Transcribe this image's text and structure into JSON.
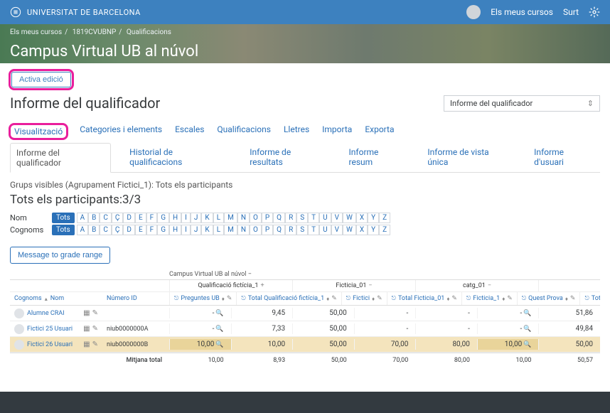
{
  "topbar": {
    "university": "UNIVERSITAT DE BARCELONA",
    "my_courses": "Els meus cursos",
    "logout": "Surt"
  },
  "breadcrumbs": [
    "Els meus cursos",
    "1819CVUBNP",
    "Qualificacions"
  ],
  "banner_title": "Campus Virtual UB al núvol",
  "edit_button": "Activa edició",
  "page_heading": "Informe del qualificador",
  "selector_value": "Informe del qualificador",
  "tabs1": [
    "Visualització",
    "Categories i elements",
    "Escales",
    "Qualificacions",
    "Lletres",
    "Importa",
    "Exporta"
  ],
  "tabs2": [
    "Informe del qualificador",
    "Historial de qualificacions",
    "Informe de resultats",
    "Informe resum",
    "Informe de vista única",
    "Informe d'usuari"
  ],
  "groups_text": "Grups visibles (Agrupament Fictici_1): Tots els participants",
  "participants_label": "Tots els participants:",
  "participants_count": "3/3",
  "letters": {
    "name_label": "Nom",
    "surname_label": "Cognoms",
    "all": "Tots",
    "alphabet": [
      "A",
      "B",
      "C",
      "Ç",
      "D",
      "E",
      "F",
      "G",
      "H",
      "I",
      "J",
      "K",
      "L",
      "M",
      "N",
      "O",
      "P",
      "Q",
      "R",
      "S",
      "T",
      "U",
      "V",
      "W",
      "X",
      "Y",
      "Z"
    ]
  },
  "message_button": "Message to grade range",
  "grade_table": {
    "top_label": "Campus Virtual UB al núvol",
    "categories": [
      {
        "label": "Qualificació fictícia_1",
        "sym": "+"
      },
      {
        "label": "Ficticia_01",
        "sym": "−"
      },
      {
        "label": "catg_01",
        "sym": "−"
      },
      {
        "label": "",
        "sym": ""
      }
    ],
    "left_headers": {
      "surname": "Cognoms",
      "name": "Nom",
      "id": "Número ID"
    },
    "columns": [
      "Preguntes UB",
      "Total Qualificació fictícia_1",
      "Fictici",
      "Total Ficticia_01",
      "Ficticia_1",
      "Quest Prova",
      "Total del curs"
    ],
    "rows": [
      {
        "name": "Alumne CRAI",
        "id": "",
        "cells": [
          "-",
          "9,45",
          "50,00",
          "-",
          "-",
          "-",
          "51,86"
        ],
        "mag": [
          true,
          false,
          false,
          false,
          false,
          true,
          false
        ]
      },
      {
        "name": "Fictici 25 Usuari",
        "id": "niub0000000A",
        "cells": [
          "-",
          "7,33",
          "50,00",
          "-",
          "-",
          "-",
          "49,84"
        ],
        "mag": [
          true,
          false,
          false,
          false,
          false,
          true,
          false
        ]
      },
      {
        "name": "Fictici 26 Usuari",
        "id": "niub0000000B",
        "cells": [
          "10,00",
          "10,00",
          "50,00",
          "70,00",
          "80,00",
          "10,00",
          "50,00"
        ],
        "mag": [
          true,
          false,
          false,
          false,
          false,
          true,
          false
        ],
        "highlight": true
      }
    ],
    "total_label": "Mitjana total",
    "totals": [
      "10,00",
      "8,93",
      "50,00",
      "70,00",
      "80,00",
      "10,00",
      "50,57"
    ]
  }
}
